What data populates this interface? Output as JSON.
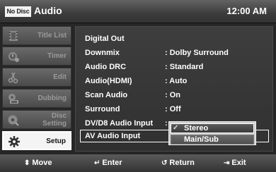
{
  "header": {
    "disc_badge": "No Disc",
    "title": "Audio",
    "clock": "12:00 AM"
  },
  "sidebar": {
    "items": [
      {
        "label": "Title List",
        "icon": "film-icon"
      },
      {
        "label": "Timer",
        "icon": "clock-icon"
      },
      {
        "label": "Edit",
        "icon": "scissors-icon"
      },
      {
        "label": "Dubbing",
        "icon": "dubbing-icon"
      },
      {
        "label": "Disc Setting",
        "icon": "disc-icon"
      },
      {
        "label": "Setup",
        "icon": "gear-icon"
      }
    ]
  },
  "settings": [
    {
      "key": "Digital Out",
      "value": ""
    },
    {
      "key": "Downmix",
      "value": ": Dolby Surround"
    },
    {
      "key": "Audio DRC",
      "value": ": Standard"
    },
    {
      "key": "Audio(HDMI)",
      "value": ": Auto"
    },
    {
      "key": "Scan Audio",
      "value": ": On"
    },
    {
      "key": "Surround",
      "value": ": Off"
    },
    {
      "key": "DV/D8 Audio Input",
      "value": ":"
    },
    {
      "key": "AV Audio Input",
      "value": ""
    }
  ],
  "popup": {
    "options": [
      {
        "check": "✓",
        "label": "Stereo"
      },
      {
        "label": "Main/Sub"
      }
    ]
  },
  "footer": {
    "move": {
      "glyph": "⬍",
      "label": "Move"
    },
    "enter": {
      "glyph": "↵",
      "label": "Enter"
    },
    "return": {
      "glyph": "↺",
      "label": "Return"
    },
    "exit": {
      "glyph": "⇥",
      "label": "Exit"
    }
  }
}
